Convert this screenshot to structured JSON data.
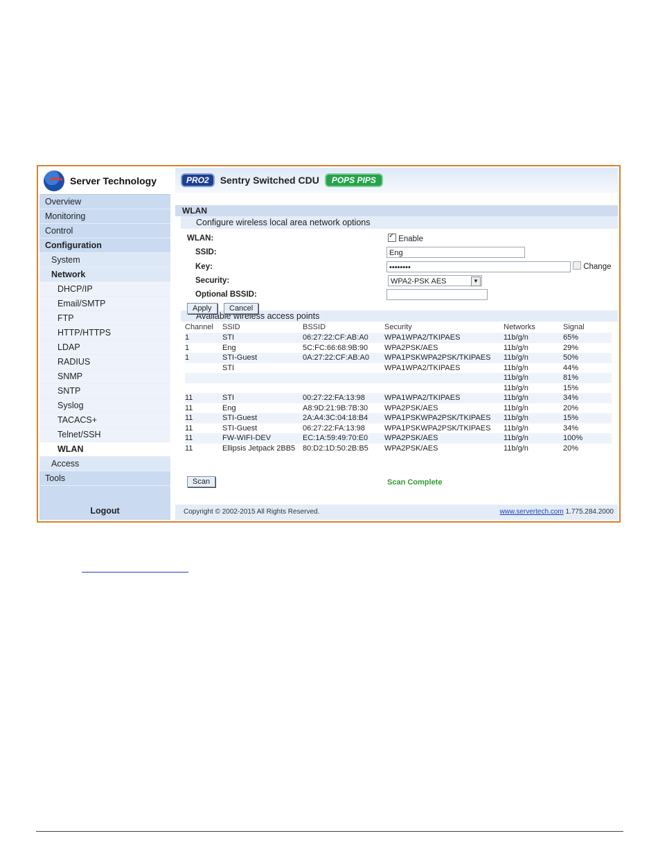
{
  "brand": "Server Technology",
  "header": {
    "badge_left": "PRO2",
    "title": "Sentry Switched CDU",
    "badge_right": "POPS PIPS"
  },
  "sidebar": {
    "items": [
      {
        "label": "Overview",
        "level": 1
      },
      {
        "label": "Monitoring",
        "level": 1
      },
      {
        "label": "Control",
        "level": 1
      },
      {
        "label": "Configuration",
        "level": 1,
        "bold": true
      },
      {
        "label": "System",
        "level": 2
      },
      {
        "label": "Network",
        "level": 2,
        "bold": true
      },
      {
        "label": "DHCP/IP",
        "level": 3
      },
      {
        "label": "Email/SMTP",
        "level": 3
      },
      {
        "label": "FTP",
        "level": 3
      },
      {
        "label": "HTTP/HTTPS",
        "level": 3
      },
      {
        "label": "LDAP",
        "level": 3
      },
      {
        "label": "RADIUS",
        "level": 3
      },
      {
        "label": "SNMP",
        "level": 3
      },
      {
        "label": "SNTP",
        "level": 3
      },
      {
        "label": "Syslog",
        "level": 3
      },
      {
        "label": "TACACS+",
        "level": 3
      },
      {
        "label": "Telnet/SSH",
        "level": 3
      },
      {
        "label": "WLAN",
        "level": 3,
        "bold": true,
        "active": true
      },
      {
        "label": "Access",
        "level": 2
      },
      {
        "label": "Tools",
        "level": 1
      }
    ],
    "logout": "Logout"
  },
  "section": {
    "title": "WLAN",
    "subtitle": "Configure wireless local area network options"
  },
  "form": {
    "wlan_label": "WLAN:",
    "enable_label": "Enable",
    "enable_checked": true,
    "ssid_label": "SSID:",
    "ssid_value": "Eng",
    "key_label": "Key:",
    "key_value": "••••••••",
    "change_label": "Change",
    "security_label": "Security:",
    "security_value": "WPA2-PSK AES",
    "bssid_label": "Optional BSSID:",
    "bssid_value": "",
    "apply_label": "Apply",
    "cancel_label": "Cancel"
  },
  "ap": {
    "title": "Available wireless access points",
    "headers": [
      "Channel",
      "SSID",
      "BSSID",
      "Security",
      "Networks",
      "Signal"
    ],
    "rows": [
      [
        "1",
        "STI",
        "06:27:22:CF:AB:A0",
        "WPA1WPA2/TKIPAES",
        "11b/g/n",
        "65%"
      ],
      [
        "1",
        "Eng",
        "5C:FC:66:68:9B:90",
        "WPA2PSK/AES",
        "11b/g/n",
        "29%"
      ],
      [
        "1",
        "STI-Guest",
        "0A:27:22:CF:AB:A0",
        "WPA1PSKWPA2PSK/TKIPAES",
        "11b/g/n",
        "50%"
      ],
      [
        "",
        "STI",
        "",
        "WPA1WPA2/TKIPAES",
        "11b/g/n",
        "44%"
      ],
      [
        "",
        "",
        "",
        "",
        "11b/g/n",
        "81%"
      ],
      [
        "",
        "",
        "",
        "",
        "11b/g/n",
        "15%"
      ],
      [
        "11",
        "STI",
        "00:27:22:FA:13:98",
        "WPA1WPA2/TKIPAES",
        "11b/g/n",
        "34%"
      ],
      [
        "11",
        "Eng",
        "A8:9D:21:9B:7B:30",
        "WPA2PSK/AES",
        "11b/g/n",
        "20%"
      ],
      [
        "11",
        "STI-Guest",
        "2A:A4:3C:04:18:B4",
        "WPA1PSKWPA2PSK/TKIPAES",
        "11b/g/n",
        "15%"
      ],
      [
        "11",
        "STI-Guest",
        "06:27:22:FA:13:98",
        "WPA1PSKWPA2PSK/TKIPAES",
        "11b/g/n",
        "34%"
      ],
      [
        "11",
        "FW-WIFI-DEV",
        "EC:1A:59:49:70:E0",
        "WPA2PSK/AES",
        "11b/g/n",
        "100%"
      ],
      [
        "11",
        "Ellipsis Jetpack 2BB5",
        "80:D2:1D:50:2B:B5",
        "WPA2PSK/AES",
        "11b/g/n",
        "20%"
      ]
    ],
    "scan_label": "Scan",
    "scan_status": "Scan Complete"
  },
  "footer": {
    "copyright": "Copyright © 2002-2015 All Rights Reserved.",
    "link": "www.servertech.com",
    "phone": "1.775.284.2000"
  },
  "colors": {
    "frame": "#d9822b",
    "sidebar": "#c9daf1",
    "status_ok": "#2f9a31",
    "link": "#1a3fb8"
  }
}
